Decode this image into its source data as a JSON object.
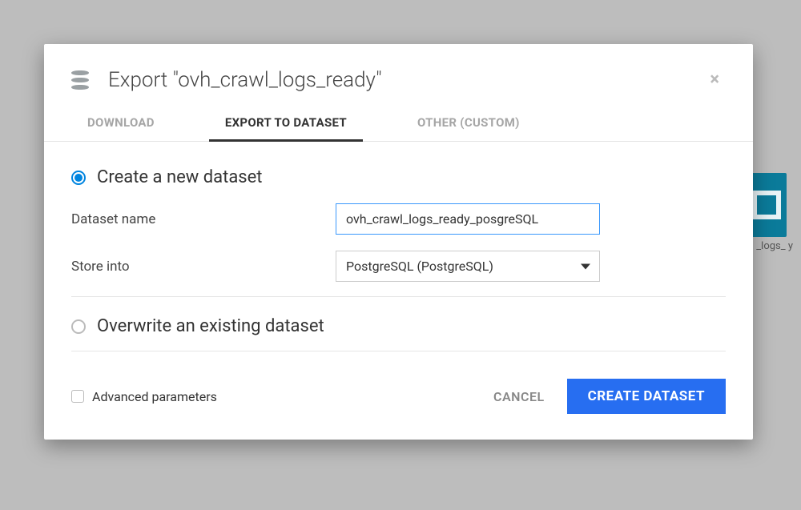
{
  "background": {
    "tile_label": "_logs_\ny"
  },
  "dialog": {
    "title": "Export \"ovh_crawl_logs_ready\"",
    "tabs": [
      {
        "label": "DOWNLOAD"
      },
      {
        "label": "EXPORT TO DATASET",
        "active": true
      },
      {
        "label": "OTHER (CUSTOM)"
      }
    ],
    "options": {
      "create": {
        "label": "Create a new dataset",
        "selected": true,
        "fields": {
          "name_label": "Dataset name",
          "name_value": "ovh_crawl_logs_ready_posgreSQL",
          "store_label": "Store into",
          "store_value": "PostgreSQL (PostgreSQL)"
        }
      },
      "overwrite": {
        "label": "Overwrite an existing dataset",
        "selected": false
      }
    },
    "footer": {
      "advanced_label": "Advanced parameters",
      "advanced_checked": false,
      "cancel": "CANCEL",
      "submit": "CREATE DATASET"
    }
  }
}
